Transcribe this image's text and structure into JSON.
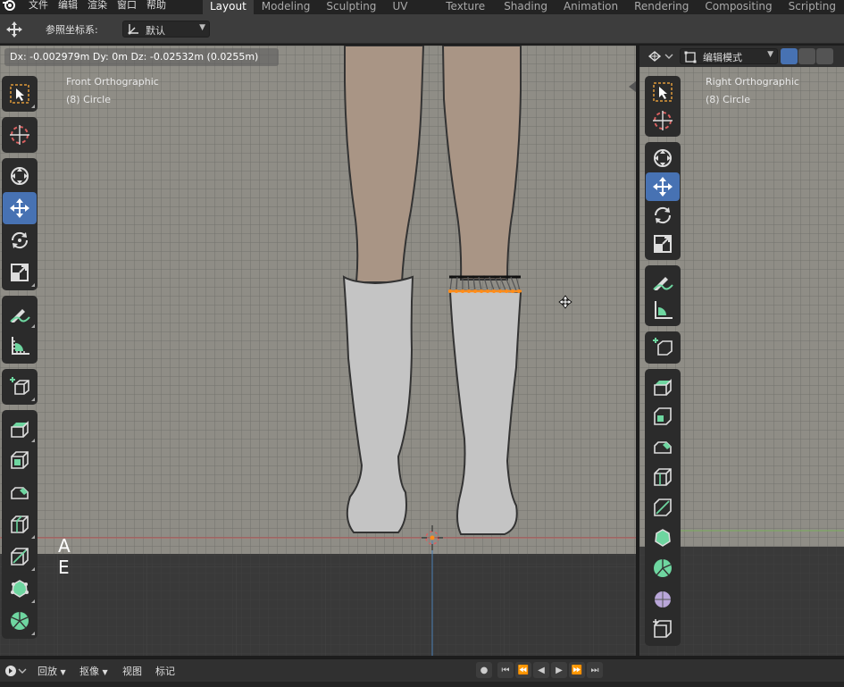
{
  "menu": {
    "items": [
      "文件",
      "编辑",
      "渲染",
      "窗口",
      "帮助"
    ]
  },
  "workspace_tabs": [
    {
      "label": "Layout",
      "active": true
    },
    {
      "label": "Modeling",
      "active": false
    },
    {
      "label": "Sculpting",
      "active": false
    },
    {
      "label": "UV Editing",
      "active": false
    },
    {
      "label": "Texture Paint",
      "active": false
    },
    {
      "label": "Shading",
      "active": false
    },
    {
      "label": "Animation",
      "active": false
    },
    {
      "label": "Rendering",
      "active": false
    },
    {
      "label": "Compositing",
      "active": false
    },
    {
      "label": "Scripting",
      "active": false
    }
  ],
  "tool_header": {
    "orientation_label": "参照坐标系:",
    "orientation_value": "默认"
  },
  "left_viewport": {
    "transform_status": "Dx: -0.002979m   Dy: 0m   Dz: -0.02532m (0.0255m)",
    "view_name": "Front Orthographic",
    "object_name": "(8) Circle",
    "key_hint_line1": "A",
    "key_hint_line2": "E"
  },
  "right_viewport": {
    "mode_value": "编辑模式",
    "view_name": "Right Orthographic",
    "object_name": "(8) Circle"
  },
  "timeline": {
    "playback_label": "回放",
    "keying_label": "抠像",
    "view_label": "视图",
    "marker_label": "标记"
  },
  "colors": {
    "accent": "#4772b3",
    "viewport_bg": "#393939",
    "skin": "#a99585",
    "boot": "#c4c4c4",
    "selected_vertex": "#ff8c1a"
  }
}
